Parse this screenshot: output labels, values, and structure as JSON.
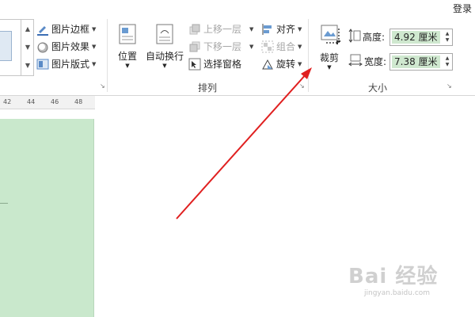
{
  "app": {
    "login_label": "登录"
  },
  "picture_styles": {
    "border_label": "图片边框",
    "effects_label": "图片效果",
    "layout_label": "图片版式"
  },
  "arrange": {
    "group_label": "排列",
    "position_label": "位置",
    "wrap_label": "自动换行",
    "bring_forward_label": "上移一层",
    "send_backward_label": "下移一层",
    "selection_pane_label": "选择窗格",
    "align_label": "对齐",
    "group_obj_label": "组合",
    "rotate_label": "旋转"
  },
  "size": {
    "group_label": "大小",
    "crop_label": "裁剪",
    "height_label": "高度:",
    "height_value": "4.92 厘米",
    "width_label": "宽度:",
    "width_value": "7.38 厘米"
  },
  "ruler": {
    "ticks": [
      "42",
      "44",
      "46",
      "48"
    ]
  },
  "watermark": {
    "logo": "Bai 经验",
    "sub": "jingyan.baidu.com"
  },
  "colors": {
    "shape_fill": "#c9e8cc",
    "annotation_arrow": "#e02020",
    "value_highlight": "#cfe8cf"
  }
}
